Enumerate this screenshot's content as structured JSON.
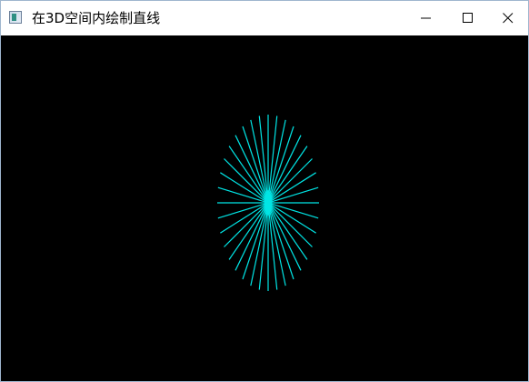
{
  "window": {
    "title": "在3D空间内绘制直线",
    "background": "#000000"
  },
  "titlebar": {
    "app_icon": "window-app-icon",
    "buttons": [
      {
        "name": "minimize",
        "icon": "minimize-icon"
      },
      {
        "name": "maximize",
        "icon": "maximize-icon"
      },
      {
        "name": "close",
        "icon": "close-icon"
      }
    ]
  },
  "scene": {
    "line_color": "#00e5e5",
    "line_count": 36
  }
}
